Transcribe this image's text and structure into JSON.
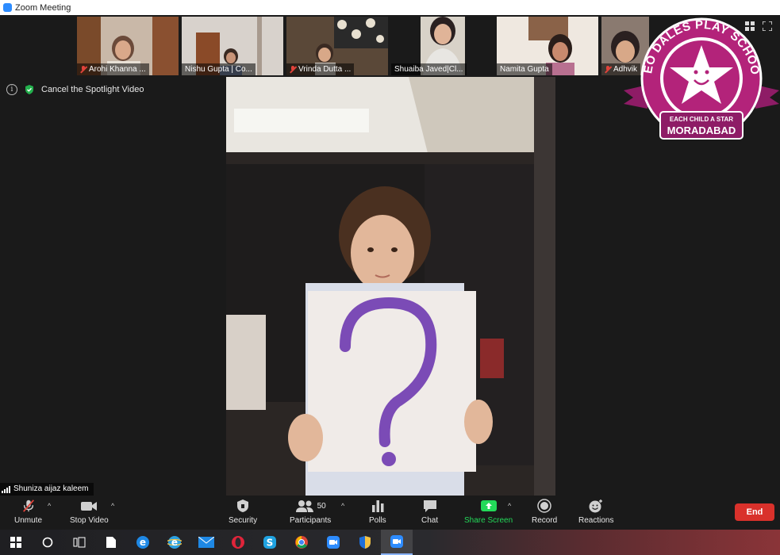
{
  "window": {
    "title": "Zoom Meeting"
  },
  "participants_strip": [
    {
      "name": "Arohi Khanna ...",
      "muted": true
    },
    {
      "name": "Nishu Gupta | Co...",
      "muted": false
    },
    {
      "name": "Vrinda Dutta ...",
      "muted": true
    },
    {
      "name": "Shuaiba Javed|Cl...",
      "muted": false
    },
    {
      "name": "Namita Gupta",
      "muted": false
    },
    {
      "name": "Adhvik",
      "muted": true
    }
  ],
  "spotlight": {
    "cancel_label": "Cancel the Spotlight Video"
  },
  "active_speaker": {
    "name": "Shuniza aijaz kaleem"
  },
  "logo": {
    "line1": "NEO DALES PLAY SCHOOL",
    "line2": "EACH CHILD A STAR",
    "line3": "MORADABAD",
    "color": "#b3237a"
  },
  "toolbar": {
    "unmute": "Unmute",
    "stop_video": "Stop Video",
    "security": "Security",
    "participants": "Participants",
    "participants_count": "50",
    "polls": "Polls",
    "chat": "Chat",
    "share_screen": "Share Screen",
    "record": "Record",
    "reactions": "Reactions",
    "end": "End"
  },
  "colors": {
    "share_green": "#23d959",
    "end_red": "#d9312b",
    "zoom_blue": "#2d8cff"
  },
  "taskbar_icons": [
    "windows-start-icon",
    "search-circle-icon",
    "task-view-icon",
    "file-icon",
    "edge-legacy-icon",
    "ie-icon",
    "mail-icon",
    "opera-icon",
    "skype-icon",
    "chrome-icon",
    "zoom-icon",
    "shield-app-icon",
    "zoom-active-icon"
  ]
}
